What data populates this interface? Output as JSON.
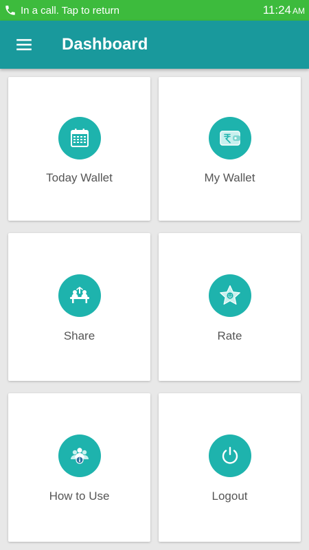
{
  "status_bar": {
    "call_text": "In a call. Tap to return",
    "time": "11:24",
    "ampm": "AM",
    "icon": "phone-icon"
  },
  "app_bar": {
    "title": "Dashboard",
    "menu_icon": "hamburger-menu-icon"
  },
  "colors": {
    "status_bar": "#3dbb3d",
    "app_bar": "#19999c",
    "icon_circle": "#1eb3ad",
    "background": "#e8e8e8",
    "card": "#ffffff",
    "label_text": "#555555"
  },
  "dashboard": {
    "cards": [
      {
        "label": "Today Wallet",
        "icon": "calendar-icon"
      },
      {
        "label": "My Wallet",
        "icon": "wallet-icon"
      },
      {
        "label": "Share",
        "icon": "share-people-icon"
      },
      {
        "label": "Rate",
        "icon": "star-icon"
      },
      {
        "label": "How to Use",
        "icon": "help-users-icon"
      },
      {
        "label": "Logout",
        "icon": "power-icon"
      }
    ]
  }
}
